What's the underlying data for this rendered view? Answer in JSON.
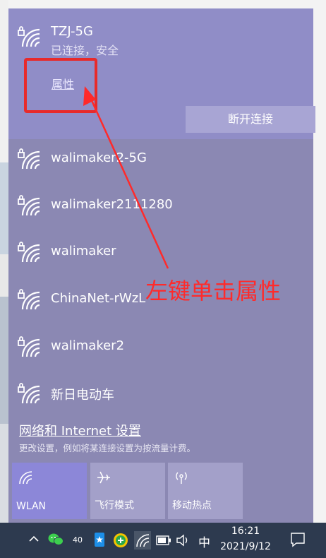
{
  "connected_network": {
    "name": "TZJ-5G",
    "status": "已连接，安全",
    "properties_label": "属性",
    "disconnect_label": "断开连接"
  },
  "networks": [
    {
      "name": "walimaker2-5G"
    },
    {
      "name": "walimaker2111280"
    },
    {
      "name": "walimaker"
    },
    {
      "name": "ChinaNet-rWzL"
    },
    {
      "name": "walimaker2"
    },
    {
      "name": "新日电动车"
    }
  ],
  "network_settings": {
    "link_label": "网络和 Internet 设置",
    "description": "更改设置，例如将某连接设置为按流量计费。"
  },
  "quick_actions": [
    {
      "label": "WLAN",
      "icon": "wifi-icon",
      "active": true
    },
    {
      "label": "飞行模式",
      "icon": "airplane-icon",
      "active": false
    },
    {
      "label": "移动热点",
      "icon": "hotspot-icon",
      "active": false
    }
  ],
  "annotation": {
    "text": "左键单击属性",
    "color": "#ff2a2a"
  },
  "taskbar": {
    "badge_count": "40",
    "ime_label": "中",
    "time": "16:21",
    "date": "2021/9/12"
  },
  "colors": {
    "panel": "#8b88b3",
    "connected_bg": "#908dc7",
    "active_tile": "#8c87d8",
    "taskbar": "#2d3a4f"
  }
}
